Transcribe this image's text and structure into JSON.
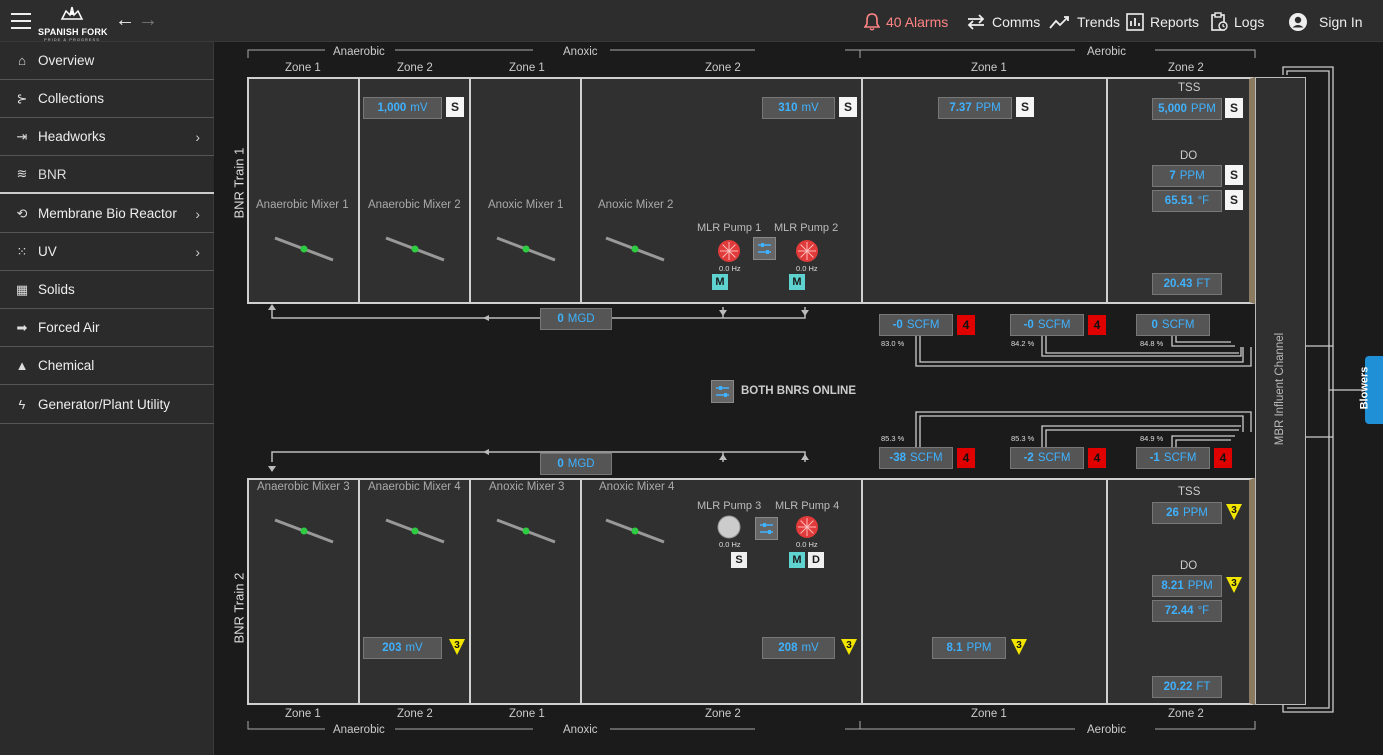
{
  "header": {
    "logo_text": "SPANISH FORK",
    "logo_sub": "PRIDE & PROGRESS",
    "alarms": "40 Alarms",
    "comms": "Comms",
    "trends": "Trends",
    "reports": "Reports",
    "logs": "Logs",
    "signin": "Sign In"
  },
  "sidebar": {
    "items": [
      {
        "label": "Overview",
        "icon": "home-icon"
      },
      {
        "label": "Collections",
        "icon": "collections-icon"
      },
      {
        "label": "Headworks",
        "icon": "headworks-icon"
      },
      {
        "label": "BNR",
        "icon": "waves-icon"
      },
      {
        "label": "Membrane Bio Reactor",
        "icon": "membrane-icon"
      },
      {
        "label": "UV",
        "icon": "uv-icon"
      },
      {
        "label": "Solids",
        "icon": "solids-icon"
      },
      {
        "label": "Forced Air",
        "icon": "arrow-icon"
      },
      {
        "label": "Chemical",
        "icon": "flask-icon"
      },
      {
        "label": "Generator/Plant Utility",
        "icon": "bolt-icon"
      }
    ]
  },
  "process": {
    "top_headers": {
      "anaerobic": "Anaerobic",
      "anoxic": "Anoxic",
      "aerobic": "Aerobic"
    },
    "zones": {
      "z1": "Zone 1",
      "z2": "Zone 2"
    },
    "train1": "BNR Train 1",
    "train2": "BNR Train 2",
    "status": "BOTH BNRS ONLINE",
    "channel": "MBR Influent Channel",
    "blowers": "Blowers",
    "t1": {
      "mixers": [
        "Anaerobic Mixer 1",
        "Anaerobic Mixer 2",
        "Anoxic Mixer 1",
        "Anoxic Mixer 2"
      ],
      "mv1": {
        "v": "1,000",
        "u": "mV",
        "b": "S"
      },
      "mv2": {
        "v": "310",
        "u": "mV",
        "b": "S"
      },
      "ppm": {
        "v": "7.37",
        "u": "PPM",
        "b": "S"
      },
      "tss_label": "TSS",
      "tss": {
        "v": "5,000",
        "u": "PPM",
        "b": "S"
      },
      "do_label": "DO",
      "do": {
        "v": "7",
        "u": "PPM",
        "b": "S"
      },
      "temp": {
        "v": "65.51",
        "u": "°F",
        "b": "S"
      },
      "level": {
        "v": "20.43",
        "u": "FT"
      },
      "pump1": "MLR Pump 1",
      "pump2": "MLR Pump 2",
      "hz1": "0.0 Hz",
      "hz2": "0.0 Hz",
      "mode": "M",
      "flow": {
        "v": "0",
        "u": "MGD"
      },
      "air": [
        {
          "v": "-0",
          "u": "SCFM",
          "b": "4",
          "p": "83.0 %"
        },
        {
          "v": "-0",
          "u": "SCFM",
          "b": "4",
          "p": "84.2 %"
        },
        {
          "v": "0",
          "u": "SCFM",
          "p": "84.8 %"
        }
      ]
    },
    "t2": {
      "mixers": [
        "Anaerobic Mixer 3",
        "Anaerobic Mixer 4",
        "Anoxic Mixer 3",
        "Anoxic Mixer 4"
      ],
      "mv1": {
        "v": "203",
        "u": "mV",
        "b": "3"
      },
      "mv2": {
        "v": "208",
        "u": "mV",
        "b": "3"
      },
      "ppm": {
        "v": "8.1",
        "u": "PPM",
        "b": "3"
      },
      "tss_label": "TSS",
      "tss": {
        "v": "26",
        "u": "PPM",
        "b": "3"
      },
      "do_label": "DO",
      "do": {
        "v": "8.21",
        "u": "PPM",
        "b": "3"
      },
      "temp": {
        "v": "72.44",
        "u": "°F"
      },
      "level": {
        "v": "20.22",
        "u": "FT"
      },
      "pump3": "MLR Pump 3",
      "pump4": "MLR Pump 4",
      "hz3": "0.0 Hz",
      "hz4": "0.0 Hz",
      "mode3": "S",
      "mode4a": "M",
      "mode4b": "D",
      "flow": {
        "v": "0",
        "u": "MGD"
      },
      "air": [
        {
          "v": "-38",
          "u": "SCFM",
          "b": "4",
          "p": "85.3 %"
        },
        {
          "v": "-2",
          "u": "SCFM",
          "b": "4",
          "p": "85.3 %"
        },
        {
          "v": "-1",
          "u": "SCFM",
          "b": "4",
          "p": "84.9 %"
        }
      ]
    }
  },
  "colors": {
    "value_text": "#3fb2ff",
    "alarm_red": "#e00000",
    "warn_yellow": "#f2e600",
    "manual_cyan": "#5fd3d0",
    "pump_red": "#e03a3a"
  }
}
